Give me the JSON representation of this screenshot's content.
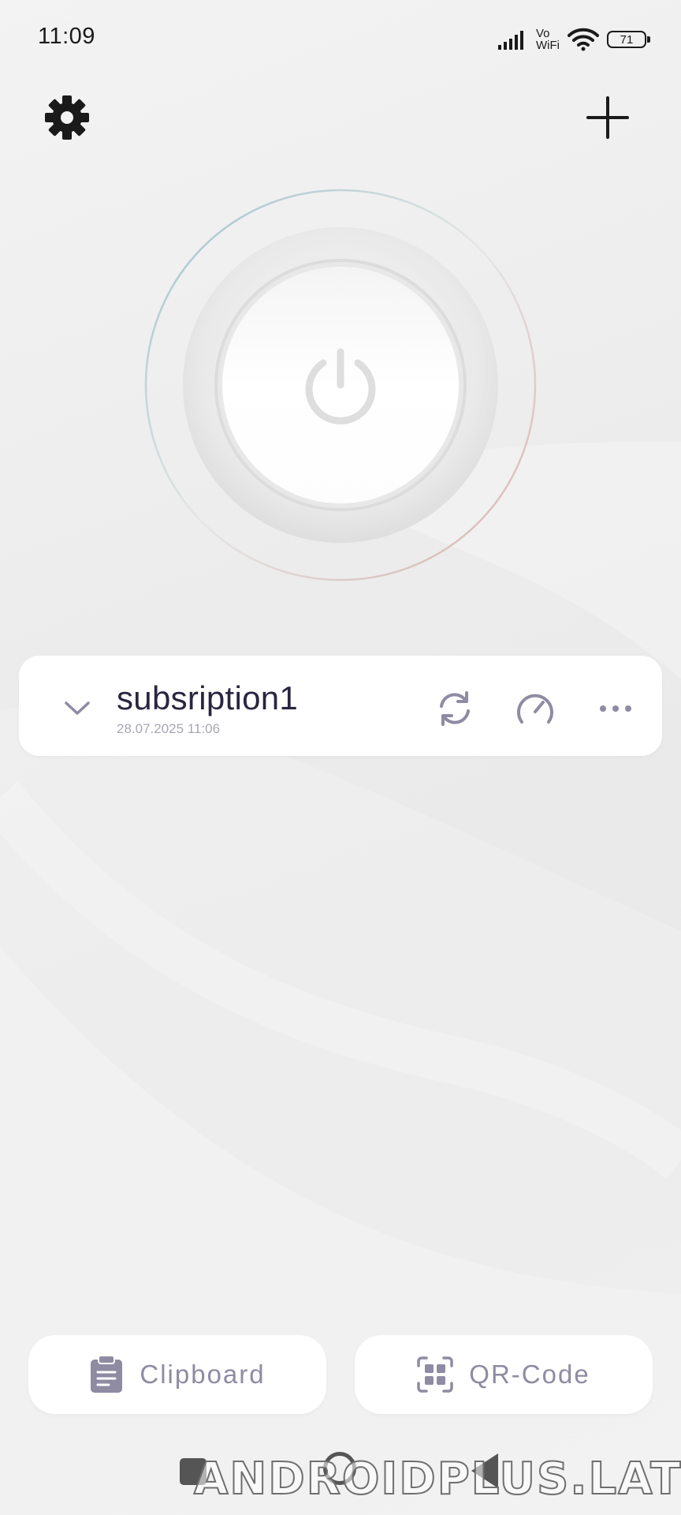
{
  "status_bar": {
    "time": "11:09",
    "network_line1": "Vo",
    "network_line2": "WiFi",
    "battery_level": "71"
  },
  "header": {
    "settings_icon": "gear-icon",
    "add_icon": "plus-icon"
  },
  "power": {
    "icon": "power-icon",
    "ring_colors": [
      "#9dc2c8",
      "#d9b0b0"
    ]
  },
  "subscription": {
    "name": "subsription1",
    "updated": "28.07.2025 11:06",
    "icons": [
      "chevron-down-icon",
      "refresh-icon",
      "speedometer-icon",
      "more-horizontal-icon"
    ]
  },
  "bottom": {
    "clipboard_label": "Clipboard",
    "qr_label": "QR-Code"
  },
  "accent_color": "#8e8ba3",
  "watermark": "ANDROIDPLUS.LAT"
}
